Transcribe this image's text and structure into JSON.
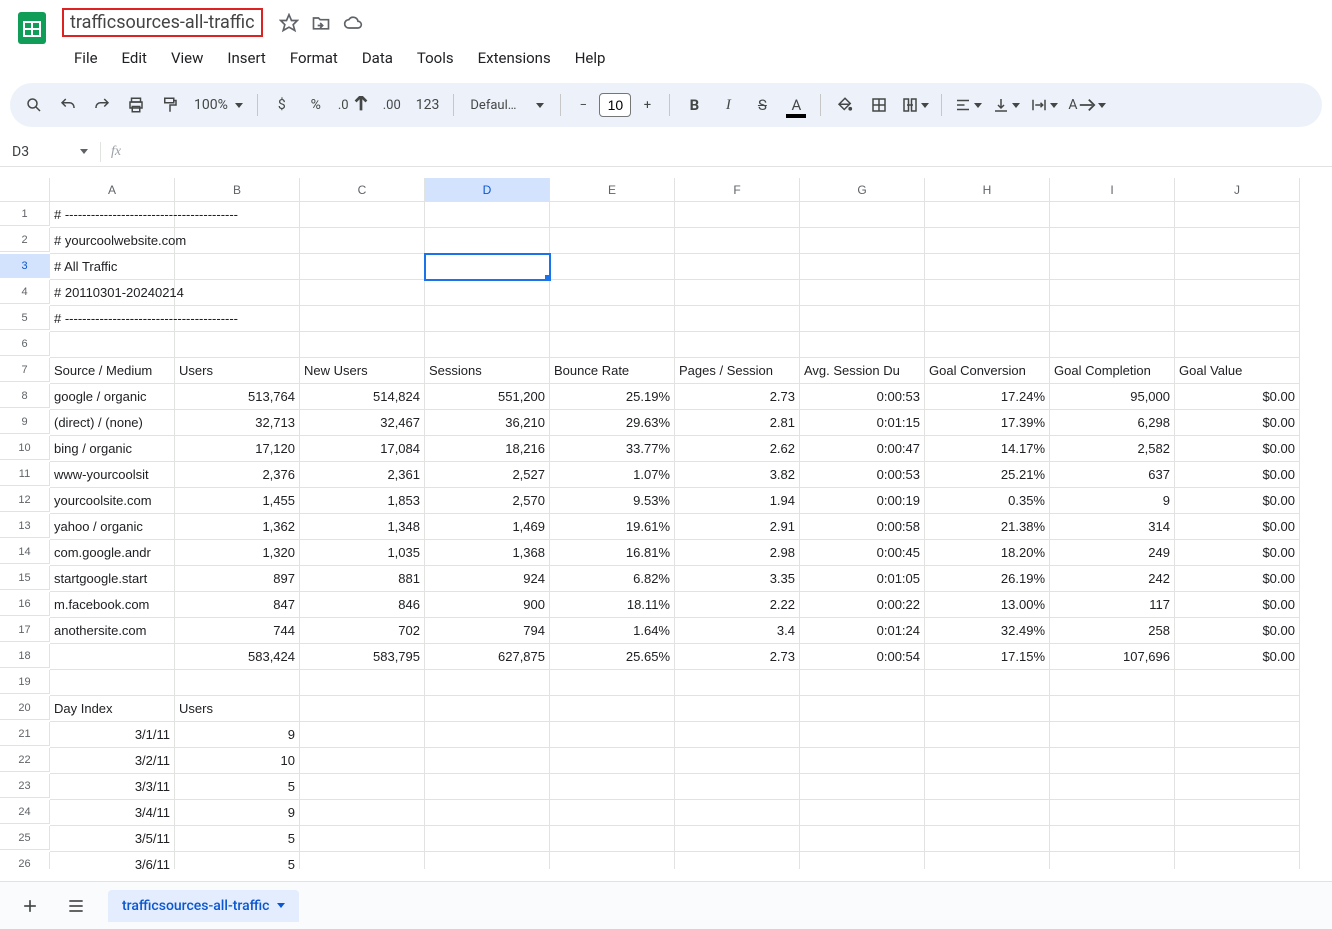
{
  "doc": {
    "title": "trafficsources-all-traffic"
  },
  "menubar": [
    "File",
    "Edit",
    "View",
    "Insert",
    "Format",
    "Data",
    "Tools",
    "Extensions",
    "Help"
  ],
  "toolbar": {
    "zoom": "100%",
    "font": "Defaul…",
    "fontsize": "10",
    "text_color_swatch": "#000000",
    "fill_color_swatch": "#ffffff"
  },
  "namebox": "D3",
  "columns": [
    "A",
    "B",
    "C",
    "D",
    "E",
    "F",
    "G",
    "H",
    "I",
    "J"
  ],
  "active_cell": {
    "row": 3,
    "col": 4
  },
  "rows": [
    {
      "n": 1,
      "cells": [
        "# ----------------------------------------",
        "",
        "",
        "",
        "",
        "",
        "",
        "",
        "",
        ""
      ],
      "align": [
        "l",
        "l",
        "l",
        "l",
        "l",
        "l",
        "l",
        "l",
        "l",
        "l"
      ],
      "of": [
        0
      ]
    },
    {
      "n": 2,
      "cells": [
        "# yourcoolwebsite.com",
        "",
        "",
        "",
        "",
        "",
        "",
        "",
        "",
        ""
      ],
      "align": [
        "l",
        "l",
        "l",
        "l",
        "l",
        "l",
        "l",
        "l",
        "l",
        "l"
      ],
      "of": [
        0
      ]
    },
    {
      "n": 3,
      "cells": [
        "# All Traffic",
        "",
        "",
        "",
        "",
        "",
        "",
        "",
        "",
        ""
      ],
      "align": [
        "l",
        "l",
        "l",
        "l",
        "l",
        "l",
        "l",
        "l",
        "l",
        "l"
      ]
    },
    {
      "n": 4,
      "cells": [
        "# 20110301-20240214",
        "",
        "",
        "",
        "",
        "",
        "",
        "",
        "",
        ""
      ],
      "align": [
        "l",
        "l",
        "l",
        "l",
        "l",
        "l",
        "l",
        "l",
        "l",
        "l"
      ],
      "of": [
        0
      ]
    },
    {
      "n": 5,
      "cells": [
        "# ----------------------------------------",
        "",
        "",
        "",
        "",
        "",
        "",
        "",
        "",
        ""
      ],
      "align": [
        "l",
        "l",
        "l",
        "l",
        "l",
        "l",
        "l",
        "l",
        "l",
        "l"
      ],
      "of": [
        0
      ]
    },
    {
      "n": 6,
      "cells": [
        "",
        "",
        "",
        "",
        "",
        "",
        "",
        "",
        "",
        ""
      ],
      "align": [
        "l",
        "l",
        "l",
        "l",
        "l",
        "l",
        "l",
        "l",
        "l",
        "l"
      ]
    },
    {
      "n": 7,
      "cells": [
        "Source / Medium",
        "Users",
        "New Users",
        "Sessions",
        "Bounce Rate",
        "Pages / Session",
        "Avg. Session Du",
        "Goal Conversion",
        "Goal Completion",
        "Goal Value"
      ],
      "align": [
        "l",
        "l",
        "l",
        "l",
        "l",
        "l",
        "l",
        "l",
        "l",
        "l"
      ]
    },
    {
      "n": 8,
      "cells": [
        "google / organic",
        "513,764",
        "514,824",
        "551,200",
        "25.19%",
        "2.73",
        "0:00:53",
        "17.24%",
        "95,000",
        "$0.00"
      ],
      "align": [
        "l",
        "r",
        "r",
        "r",
        "r",
        "r",
        "r",
        "r",
        "r",
        "r"
      ]
    },
    {
      "n": 9,
      "cells": [
        "(direct) / (none)",
        "32,713",
        "32,467",
        "36,210",
        "29.63%",
        "2.81",
        "0:01:15",
        "17.39%",
        "6,298",
        "$0.00"
      ],
      "align": [
        "l",
        "r",
        "r",
        "r",
        "r",
        "r",
        "r",
        "r",
        "r",
        "r"
      ]
    },
    {
      "n": 10,
      "cells": [
        "bing / organic",
        "17,120",
        "17,084",
        "18,216",
        "33.77%",
        "2.62",
        "0:00:47",
        "14.17%",
        "2,582",
        "$0.00"
      ],
      "align": [
        "l",
        "r",
        "r",
        "r",
        "r",
        "r",
        "r",
        "r",
        "r",
        "r"
      ]
    },
    {
      "n": 11,
      "cells": [
        "www-yourcoolsit",
        "2,376",
        "2,361",
        "2,527",
        "1.07%",
        "3.82",
        "0:00:53",
        "25.21%",
        "637",
        "$0.00"
      ],
      "align": [
        "l",
        "r",
        "r",
        "r",
        "r",
        "r",
        "r",
        "r",
        "r",
        "r"
      ]
    },
    {
      "n": 12,
      "cells": [
        "yourcoolsite.com",
        "1,455",
        "1,853",
        "2,570",
        "9.53%",
        "1.94",
        "0:00:19",
        "0.35%",
        "9",
        "$0.00"
      ],
      "align": [
        "l",
        "r",
        "r",
        "r",
        "r",
        "r",
        "r",
        "r",
        "r",
        "r"
      ]
    },
    {
      "n": 13,
      "cells": [
        "yahoo / organic",
        "1,362",
        "1,348",
        "1,469",
        "19.61%",
        "2.91",
        "0:00:58",
        "21.38%",
        "314",
        "$0.00"
      ],
      "align": [
        "l",
        "r",
        "r",
        "r",
        "r",
        "r",
        "r",
        "r",
        "r",
        "r"
      ]
    },
    {
      "n": 14,
      "cells": [
        "com.google.andr",
        "1,320",
        "1,035",
        "1,368",
        "16.81%",
        "2.98",
        "0:00:45",
        "18.20%",
        "249",
        "$0.00"
      ],
      "align": [
        "l",
        "r",
        "r",
        "r",
        "r",
        "r",
        "r",
        "r",
        "r",
        "r"
      ]
    },
    {
      "n": 15,
      "cells": [
        "startgoogle.start",
        "897",
        "881",
        "924",
        "6.82%",
        "3.35",
        "0:01:05",
        "26.19%",
        "242",
        "$0.00"
      ],
      "align": [
        "l",
        "r",
        "r",
        "r",
        "r",
        "r",
        "r",
        "r",
        "r",
        "r"
      ]
    },
    {
      "n": 16,
      "cells": [
        "m.facebook.com",
        "847",
        "846",
        "900",
        "18.11%",
        "2.22",
        "0:00:22",
        "13.00%",
        "117",
        "$0.00"
      ],
      "align": [
        "l",
        "r",
        "r",
        "r",
        "r",
        "r",
        "r",
        "r",
        "r",
        "r"
      ]
    },
    {
      "n": 17,
      "cells": [
        "anothersite.com",
        "744",
        "702",
        "794",
        "1.64%",
        "3.4",
        "0:01:24",
        "32.49%",
        "258",
        "$0.00"
      ],
      "align": [
        "l",
        "r",
        "r",
        "r",
        "r",
        "r",
        "r",
        "r",
        "r",
        "r"
      ]
    },
    {
      "n": 18,
      "cells": [
        "",
        "583,424",
        "583,795",
        "627,875",
        "25.65%",
        "2.73",
        "0:00:54",
        "17.15%",
        "107,696",
        "$0.00"
      ],
      "align": [
        "l",
        "r",
        "r",
        "r",
        "r",
        "r",
        "r",
        "r",
        "r",
        "r"
      ]
    },
    {
      "n": 19,
      "cells": [
        "",
        "",
        "",
        "",
        "",
        "",
        "",
        "",
        "",
        ""
      ],
      "align": [
        "l",
        "l",
        "l",
        "l",
        "l",
        "l",
        "l",
        "l",
        "l",
        "l"
      ]
    },
    {
      "n": 20,
      "cells": [
        "Day Index",
        "Users",
        "",
        "",
        "",
        "",
        "",
        "",
        "",
        ""
      ],
      "align": [
        "l",
        "l",
        "l",
        "l",
        "l",
        "l",
        "l",
        "l",
        "l",
        "l"
      ]
    },
    {
      "n": 21,
      "cells": [
        "3/1/11",
        "9",
        "",
        "",
        "",
        "",
        "",
        "",
        "",
        ""
      ],
      "align": [
        "r",
        "r",
        "l",
        "l",
        "l",
        "l",
        "l",
        "l",
        "l",
        "l"
      ]
    },
    {
      "n": 22,
      "cells": [
        "3/2/11",
        "10",
        "",
        "",
        "",
        "",
        "",
        "",
        "",
        ""
      ],
      "align": [
        "r",
        "r",
        "l",
        "l",
        "l",
        "l",
        "l",
        "l",
        "l",
        "l"
      ]
    },
    {
      "n": 23,
      "cells": [
        "3/3/11",
        "5",
        "",
        "",
        "",
        "",
        "",
        "",
        "",
        ""
      ],
      "align": [
        "r",
        "r",
        "l",
        "l",
        "l",
        "l",
        "l",
        "l",
        "l",
        "l"
      ]
    },
    {
      "n": 24,
      "cells": [
        "3/4/11",
        "9",
        "",
        "",
        "",
        "",
        "",
        "",
        "",
        ""
      ],
      "align": [
        "r",
        "r",
        "l",
        "l",
        "l",
        "l",
        "l",
        "l",
        "l",
        "l"
      ]
    },
    {
      "n": 25,
      "cells": [
        "3/5/11",
        "5",
        "",
        "",
        "",
        "",
        "",
        "",
        "",
        ""
      ],
      "align": [
        "r",
        "r",
        "l",
        "l",
        "l",
        "l",
        "l",
        "l",
        "l",
        "l"
      ]
    },
    {
      "n": 26,
      "cells": [
        "3/6/11",
        "5",
        "",
        "",
        "",
        "",
        "",
        "",
        "",
        ""
      ],
      "align": [
        "r",
        "r",
        "l",
        "l",
        "l",
        "l",
        "l",
        "l",
        "l",
        "l"
      ]
    }
  ],
  "sheet_tab": "trafficsources-all-traffic"
}
